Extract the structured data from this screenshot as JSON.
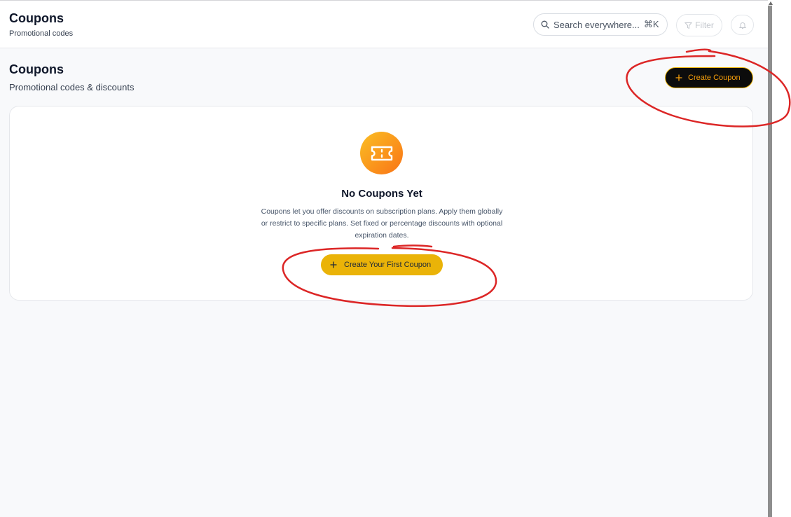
{
  "header": {
    "title": "Coupons",
    "subtitle": "Promotional codes",
    "search_placeholder": "Search everywhere...",
    "search_shortcut": "⌘K",
    "filter_label": "Filter",
    "notifications_icon": "bell-icon"
  },
  "page": {
    "title": "Coupons",
    "subtitle": "Promotional codes & discounts",
    "create_button_label": "Create Coupon"
  },
  "empty_state": {
    "icon": "ticket-icon",
    "title": "No Coupons Yet",
    "description": "Coupons let you offer discounts on subscription plans. Apply them globally or restrict to specific plans. Set fixed or percentage discounts with optional expiration dates.",
    "button_label": "Create Your First Coupon"
  },
  "colors": {
    "accent": "#eab308",
    "accent_text": "#f59e0b",
    "dark_button": "#0c0c0c",
    "annotation": "#dc2626"
  }
}
